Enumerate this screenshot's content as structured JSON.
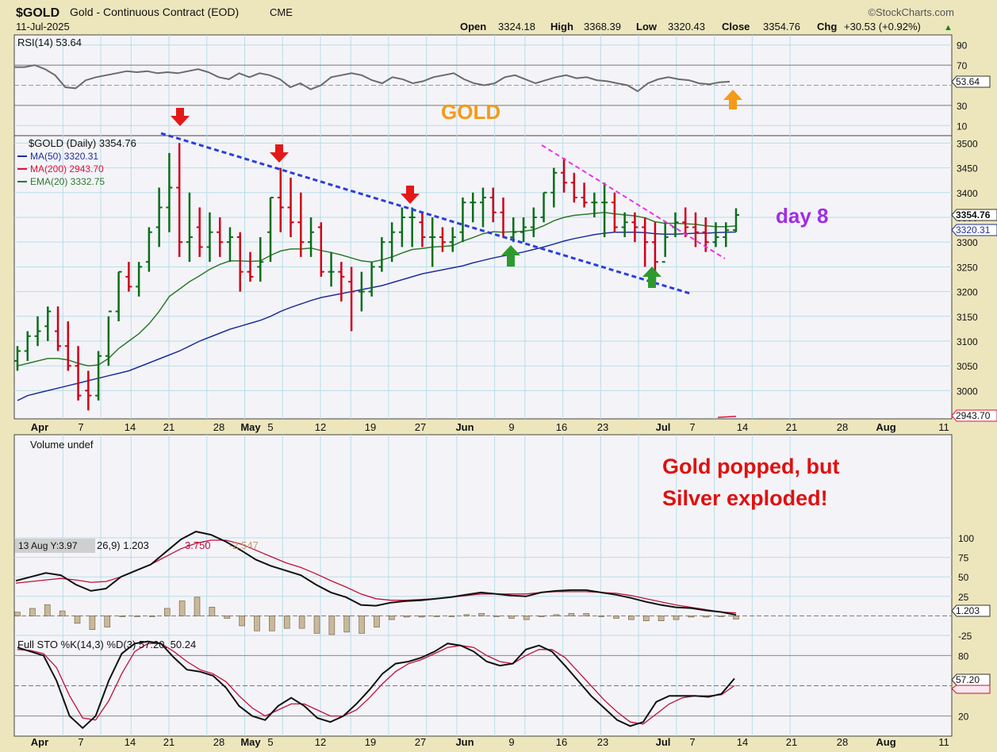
{
  "header": {
    "symbol": "$GOLD",
    "description": "Gold - Continuous Contract (EOD)",
    "exchange": "CME",
    "date": "11-Jul-2025",
    "brand": "©StockCharts.com",
    "ohlc_labels": [
      "Open",
      "High",
      "Low",
      "Close",
      "Chg"
    ],
    "ohlc_values": [
      "3324.18",
      "3368.39",
      "3320.43",
      "3354.76",
      "+30.53 (+0.92%)"
    ],
    "chg_arrow": "▲"
  },
  "annotations": {
    "gold_label": "GOLD",
    "day_label": "day 8",
    "note_line1": "Gold popped, but",
    "note_line2": "Silver exploded!",
    "tooltip": "13 Aug Y:3.97"
  },
  "colors": {
    "background": "#ede6bd",
    "panel": "#f4f4f8",
    "grid": "#b9dde8",
    "up_bar": "#0a6e1a",
    "down_bar": "#d00018",
    "ma50": "#1f2f9a",
    "ma200": "#e0103a",
    "ema20": "#2d7a2d",
    "trend_blue": "#2b3de0",
    "trend_pink": "#ee32e0",
    "accent_orange": "#f59a1a",
    "accent_purple": "#a12be8",
    "note_red": "#e01010"
  },
  "chart_data": [
    {
      "type": "line",
      "title": "RSI(14) 53.64",
      "series": [
        {
          "name": "RSI(14)",
          "values": [
            68,
            68,
            70,
            66,
            60,
            48,
            47,
            55,
            58,
            60,
            62,
            64,
            63,
            64,
            62,
            63,
            62,
            64,
            66,
            63,
            58,
            56,
            62,
            58,
            62,
            60,
            56,
            48,
            52,
            46,
            50,
            58,
            60,
            62,
            60,
            55,
            52,
            58,
            56,
            52,
            54,
            58,
            60,
            62,
            56,
            52,
            50,
            52,
            58,
            60,
            56,
            52,
            55,
            58,
            60,
            57,
            58,
            55,
            54,
            52,
            50,
            44,
            52,
            56,
            58,
            56,
            55,
            52,
            51,
            53,
            53.64
          ]
        }
      ],
      "ylim": [
        0,
        100
      ],
      "yticks": [
        "90",
        "70",
        "30",
        "10"
      ],
      "last_value": "53.64"
    },
    {
      "type": "bar",
      "title": "$GOLD (Daily) 3354.76",
      "legend": [
        "$GOLD (Daily) 3354.76",
        "MA(50) 3320.31",
        "MA(200) 2943.70",
        "EMA(20) 3332.75"
      ],
      "x": [
        "Mar 28",
        "Mar 31",
        "Apr 1",
        "Apr 2",
        "Apr 3",
        "Apr 4",
        "Apr 7",
        "Apr 8",
        "Apr 9",
        "Apr 10",
        "Apr 11",
        "Apr 14",
        "Apr 15",
        "Apr 16",
        "Apr 17",
        "Apr 21",
        "Apr 22",
        "Apr 23",
        "Apr 24",
        "Apr 25",
        "Apr 28",
        "Apr 29",
        "Apr 30",
        "May 1",
        "May 2",
        "May 5",
        "May 6",
        "May 7",
        "May 8",
        "May 9",
        "May 12",
        "May 13",
        "May 14",
        "May 15",
        "May 16",
        "May 19",
        "May 20",
        "May 21",
        "May 22",
        "May 23",
        "May 27",
        "May 28",
        "May 29",
        "May 30",
        "Jun 2",
        "Jun 3",
        "Jun 4",
        "Jun 5",
        "Jun 6",
        "Jun 9",
        "Jun 10",
        "Jun 11",
        "Jun 12",
        "Jun 13",
        "Jun 16",
        "Jun 17",
        "Jun 18",
        "Jun 20",
        "Jun 23",
        "Jun 24",
        "Jun 25",
        "Jun 26",
        "Jun 27",
        "Jun 30",
        "Jul 1",
        "Jul 2",
        "Jul 3",
        "Jul 7",
        "Jul 8",
        "Jul 9",
        "Jul 10",
        "Jul 11"
      ],
      "series": [
        {
          "name": "Open",
          "values": [
            3060,
            3080,
            3110,
            3130,
            3120,
            3090,
            3050,
            3000,
            2990,
            3070,
            3160,
            3230,
            3210,
            3260,
            3330,
            3370,
            3410,
            3300,
            3330,
            3290,
            3320,
            3300,
            3310,
            3240,
            3250,
            3320,
            3390,
            3370,
            3340,
            3300,
            3330,
            3240,
            3240,
            3220,
            3200,
            3200,
            3250,
            3300,
            3320,
            3350,
            3340,
            3310,
            3310,
            3300,
            3320,
            3380,
            3380,
            3390,
            3360,
            3310,
            3320,
            3330,
            3350,
            3400,
            3440,
            3420,
            3390,
            3380,
            3380,
            3380,
            3330,
            3340,
            3330,
            3300,
            3260,
            3330,
            3340,
            3330,
            3320,
            3300,
            3310,
            3324.18
          ]
        },
        {
          "name": "High",
          "values": [
            3090,
            3120,
            3150,
            3170,
            3170,
            3140,
            3090,
            3040,
            3080,
            3150,
            3240,
            3260,
            3260,
            3330,
            3410,
            3480,
            3500,
            3400,
            3370,
            3360,
            3350,
            3330,
            3320,
            3280,
            3310,
            3390,
            3450,
            3430,
            3400,
            3350,
            3340,
            3280,
            3260,
            3250,
            3240,
            3260,
            3310,
            3340,
            3370,
            3370,
            3360,
            3350,
            3330,
            3330,
            3390,
            3400,
            3410,
            3410,
            3390,
            3350,
            3350,
            3370,
            3400,
            3450,
            3470,
            3440,
            3420,
            3400,
            3420,
            3400,
            3360,
            3360,
            3350,
            3340,
            3340,
            3360,
            3370,
            3360,
            3350,
            3340,
            3340,
            3368.39
          ]
        },
        {
          "name": "Low",
          "values": [
            3040,
            3060,
            3090,
            3100,
            3080,
            3040,
            2980,
            2960,
            2980,
            3050,
            3140,
            3200,
            3190,
            3240,
            3290,
            3320,
            3270,
            3260,
            3270,
            3260,
            3270,
            3260,
            3200,
            3220,
            3220,
            3260,
            3320,
            3310,
            3270,
            3270,
            3230,
            3210,
            3180,
            3120,
            3160,
            3190,
            3240,
            3260,
            3290,
            3290,
            3290,
            3250,
            3280,
            3280,
            3300,
            3340,
            3330,
            3340,
            3310,
            3300,
            3300,
            3310,
            3340,
            3370,
            3400,
            3380,
            3370,
            3350,
            3310,
            3320,
            3310,
            3300,
            3250,
            3220,
            3270,
            3310,
            3310,
            3290,
            3280,
            3290,
            3290,
            3320.43
          ]
        },
        {
          "name": "Close",
          "values": [
            3080,
            3110,
            3120,
            3160,
            3090,
            3050,
            2990,
            2990,
            3070,
            3160,
            3240,
            3210,
            3250,
            3320,
            3370,
            3410,
            3300,
            3310,
            3290,
            3320,
            3300,
            3310,
            3240,
            3230,
            3260,
            3390,
            3370,
            3340,
            3300,
            3320,
            3240,
            3240,
            3230,
            3200,
            3200,
            3250,
            3300,
            3320,
            3350,
            3350,
            3310,
            3310,
            3300,
            3310,
            3380,
            3380,
            3390,
            3360,
            3310,
            3320,
            3330,
            3350,
            3400,
            3440,
            3420,
            3390,
            3380,
            3380,
            3380,
            3330,
            3340,
            3330,
            3300,
            3260,
            3310,
            3340,
            3330,
            3320,
            3300,
            3310,
            3324,
            3354.76
          ]
        }
      ],
      "ma50": [
        2980,
        2990,
        2995,
        3000,
        3005,
        3010,
        3015,
        3020,
        3025,
        3030,
        3035,
        3040,
        3048,
        3056,
        3064,
        3072,
        3080,
        3090,
        3100,
        3108,
        3116,
        3124,
        3130,
        3136,
        3142,
        3150,
        3160,
        3168,
        3175,
        3182,
        3188,
        3192,
        3196,
        3200,
        3204,
        3208,
        3212,
        3218,
        3224,
        3230,
        3236,
        3240,
        3244,
        3248,
        3252,
        3258,
        3263,
        3268,
        3272,
        3276,
        3280,
        3285,
        3290,
        3296,
        3302,
        3307,
        3311,
        3315,
        3318,
        3320,
        3320,
        3320,
        3319,
        3317,
        3316,
        3316,
        3317,
        3318,
        3318,
        3319,
        3320,
        3320.31
      ],
      "ema20": [
        3050,
        3055,
        3060,
        3065,
        3065,
        3062,
        3055,
        3050,
        3052,
        3065,
        3085,
        3100,
        3115,
        3135,
        3160,
        3190,
        3205,
        3220,
        3232,
        3245,
        3255,
        3262,
        3262,
        3261,
        3262,
        3273,
        3282,
        3286,
        3286,
        3288,
        3283,
        3279,
        3274,
        3268,
        3262,
        3260,
        3264,
        3270,
        3278,
        3285,
        3287,
        3290,
        3291,
        3293,
        3302,
        3309,
        3317,
        3321,
        3320,
        3321,
        3322,
        3325,
        3333,
        3343,
        3350,
        3354,
        3356,
        3358,
        3360,
        3357,
        3355,
        3353,
        3349,
        3341,
        3338,
        3338,
        3337,
        3336,
        3333,
        3331,
        3331,
        3332.75
      ],
      "ylim": [
        2943,
        3515
      ],
      "yticks": [
        "3500",
        "3450",
        "3400",
        "3350",
        "3300",
        "3250",
        "3200",
        "3150",
        "3100",
        "3050",
        "3000"
      ],
      "price_labels": [
        "3354.76",
        "3320.31",
        "2943.70"
      ],
      "xaxis": [
        "Apr",
        "7",
        "14",
        "21",
        "28",
        "May",
        "5",
        "12",
        "19",
        "27",
        "Jun",
        "9",
        "16",
        "23",
        "Jul",
        "7",
        "14",
        "21",
        "28",
        "Aug",
        "11"
      ]
    },
    {
      "type": "bar",
      "title": "Volume undef"
    },
    {
      "type": "line",
      "title": "26,9) 1.203, 3.750, -2.547",
      "legend_values": [
        "26,9) 1.203",
        "3.750",
        "-2.547"
      ],
      "series": [
        {
          "name": "MACD",
          "values": [
            45,
            50,
            55,
            52,
            40,
            32,
            35,
            50,
            58,
            66,
            82,
            98,
            108,
            104,
            95,
            84,
            72,
            64,
            58,
            52,
            40,
            30,
            24,
            14,
            13,
            17,
            19,
            20,
            22,
            24,
            27,
            30,
            28,
            26,
            25,
            30,
            32,
            33,
            33,
            30,
            27,
            23,
            18,
            14,
            11,
            10,
            7,
            5,
            1.203
          ]
        },
        {
          "name": "Signal",
          "values": [
            42,
            44,
            46,
            48,
            46,
            43,
            44,
            50,
            58,
            66,
            76,
            86,
            93,
            97,
            97,
            92,
            84,
            76,
            68,
            62,
            54,
            45,
            37,
            28,
            22,
            20,
            20,
            21,
            22,
            24,
            26,
            28,
            28,
            28,
            28,
            30,
            31,
            31,
            31,
            30,
            29,
            26,
            22,
            18,
            14,
            11,
            8,
            5,
            3.75
          ]
        },
        {
          "name": "Histogram",
          "values": [
            3,
            6,
            9,
            4,
            -6,
            -11,
            -9,
            0,
            0,
            0,
            6,
            12,
            15,
            7,
            -2,
            -8,
            -12,
            -12,
            -10,
            -10,
            -14,
            -15,
            -13,
            -14,
            -9,
            -3,
            -1,
            -1,
            0,
            0,
            1,
            2,
            0,
            -2,
            -3,
            0,
            1,
            2,
            2,
            0,
            -2,
            -3,
            -4,
            -4,
            -3,
            -1,
            -1,
            0,
            -2.547
          ]
        }
      ],
      "ylim": [
        -25,
        100
      ],
      "yticks": [
        "100",
        "75",
        "50",
        "25",
        "-25"
      ],
      "last_value": "1.203"
    },
    {
      "type": "line",
      "title": "Full STO %K(14,3) %D(3) 57.20, 50.24",
      "series": [
        {
          "name": "%K(14,3)",
          "values": [
            88,
            84,
            80,
            55,
            20,
            8,
            20,
            55,
            82,
            92,
            94,
            92,
            78,
            66,
            64,
            60,
            48,
            30,
            20,
            16,
            30,
            38,
            30,
            18,
            14,
            20,
            32,
            46,
            62,
            72,
            74,
            78,
            84,
            92,
            90,
            84,
            74,
            70,
            72,
            86,
            90,
            84,
            70,
            55,
            40,
            28,
            16,
            10,
            14,
            34,
            40,
            40,
            40,
            39,
            42,
            57.2
          ]
        },
        {
          "name": "%D(3)",
          "values": [
            86,
            85,
            82,
            68,
            40,
            18,
            16,
            35,
            62,
            84,
            92,
            92,
            84,
            74,
            66,
            62,
            54,
            40,
            28,
            20,
            26,
            32,
            32,
            26,
            20,
            20,
            26,
            38,
            52,
            64,
            72,
            76,
            82,
            88,
            90,
            88,
            80,
            74,
            72,
            80,
            86,
            86,
            78,
            64,
            50,
            36,
            24,
            14,
            12,
            22,
            32,
            38,
            40,
            40,
            41,
            50.24
          ]
        }
      ],
      "ylim": [
        0,
        100
      ],
      "yticks": [
        "80",
        "20"
      ],
      "last_values": [
        "57.20",
        "50.24"
      ]
    }
  ]
}
